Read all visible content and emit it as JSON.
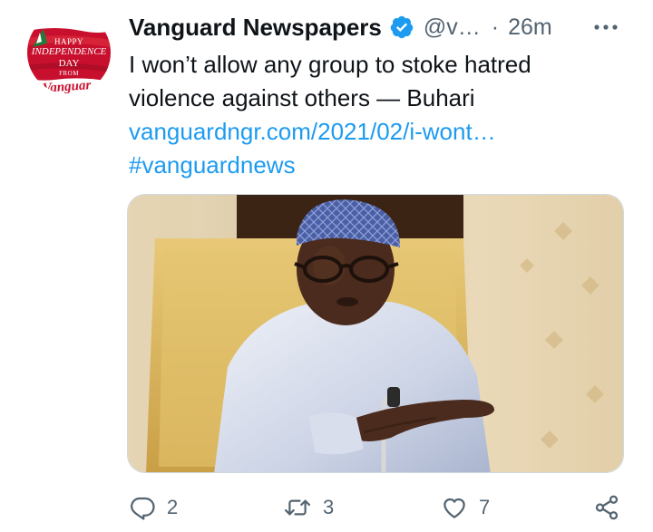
{
  "tweet": {
    "author": {
      "display_name": "Vanguard Newspapers",
      "handle": "@v…",
      "verified": true,
      "avatar": {
        "line1": "HAPPY",
        "line2": "INDEPENDENCE",
        "line3": "DAY",
        "line4": "FROM",
        "logo_text": "Vanguar"
      }
    },
    "separator": "·",
    "time": "26m",
    "more_icon": "more-horizontal-icon",
    "text": {
      "line1": "I won’t allow any group to stoke hatred",
      "line2": "violence against others — Buhari",
      "link": "vanguardngr.com/2021/02/i-wont…",
      "hashtag": "#vanguardnews"
    },
    "media": {
      "kind": "photo"
    },
    "actions": {
      "reply": {
        "icon": "reply-icon",
        "count": "2"
      },
      "retweet": {
        "icon": "retweet-icon",
        "count": "3"
      },
      "like": {
        "icon": "heart-icon",
        "count": "7"
      },
      "share": {
        "icon": "share-icon"
      }
    }
  },
  "colors": {
    "link": "#1d9bf0",
    "secondary_text": "#536471",
    "verified_badge": "#1d9bf0",
    "avatar_red": "#c8102e",
    "avatar_green": "#1e7d3a"
  }
}
